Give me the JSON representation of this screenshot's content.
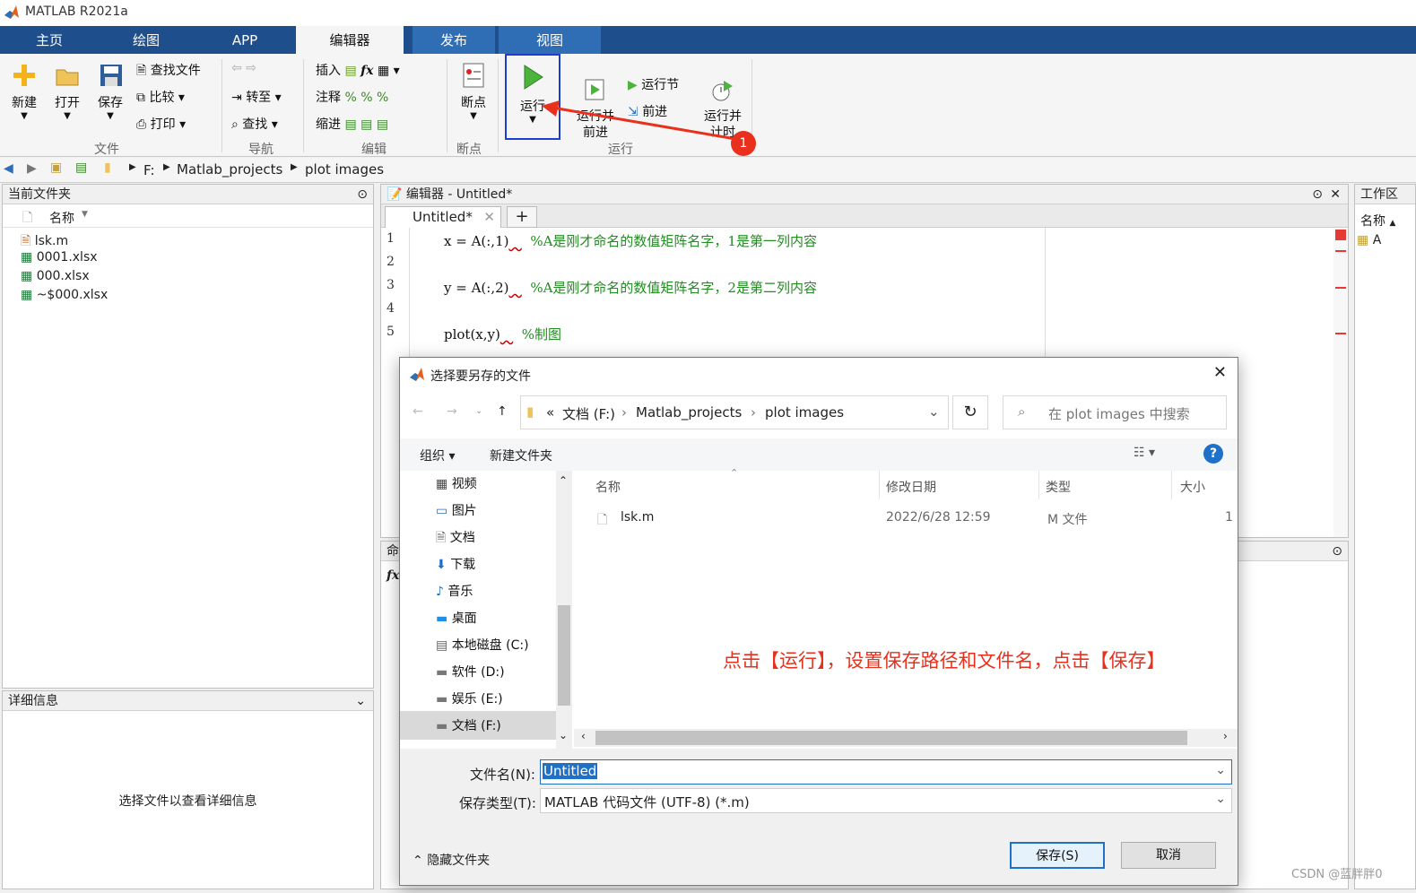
{
  "app": {
    "title": "MATLAB R2021a"
  },
  "tabs": [
    "主页",
    "绘图",
    "APP",
    "编辑器",
    "发布",
    "视图"
  ],
  "ribbon": {
    "file": {
      "new": "新建",
      "open": "打开",
      "save": "保存",
      "find_files": "查找文件",
      "compare": "比较",
      "print": "打印",
      "group": "文件"
    },
    "nav": {
      "goto": "转至",
      "find": "查找",
      "group": "导航"
    },
    "edit": {
      "insert": "插入",
      "comment": "注释",
      "indent": "缩进",
      "fx": "fx",
      "group": "编辑"
    },
    "breakpoints": {
      "label": "断点",
      "group": "断点"
    },
    "run": {
      "run": "运行",
      "run_advance": "运行并\n前进",
      "run_section": "运行节",
      "advance": "前进",
      "run_time": "运行并\n计时",
      "group": "运行",
      "annotation_badge": "1"
    }
  },
  "address": {
    "drive": "F:",
    "folder1": "Matlab_projects",
    "folder2": "plot images"
  },
  "current_folder": {
    "title": "当前文件夹",
    "col_name": "名称",
    "files": [
      "lsk.m",
      "0001.xlsx",
      "000.xlsx",
      "~$000.xlsx"
    ]
  },
  "details": {
    "title": "详细信息",
    "placeholder": "选择文件以查看详细信息"
  },
  "editor": {
    "title": "编辑器 - Untitled*",
    "tab": "Untitled*",
    "lines": [
      {
        "num": "1",
        "code": "x = A(:,1)",
        "comment": "%A是刚才命名的数值矩阵名字，1是第一列内容"
      },
      {
        "num": "2",
        "code": "",
        "comment": ""
      },
      {
        "num": "3",
        "code": "y = A(:,2)",
        "comment": "%A是刚才命名的数值矩阵名字，2是第二列内容"
      },
      {
        "num": "4",
        "code": "",
        "comment": ""
      },
      {
        "num": "5",
        "code": "plot(x,y)",
        "comment": "%制图"
      }
    ]
  },
  "command": {
    "title": "命",
    "prompt": "fx"
  },
  "workspace": {
    "title": "工作区",
    "col_name": "名称",
    "var": "A"
  },
  "dialog": {
    "title": "选择要另存的文件",
    "path_prefix": "«",
    "path": [
      "文档 (F:)",
      "Matlab_projects",
      "plot images"
    ],
    "search_placeholder": "在 plot images 中搜索",
    "organize": "组织",
    "new_folder": "新建文件夹",
    "nav": [
      "视频",
      "图片",
      "文档",
      "下载",
      "音乐",
      "桌面",
      "本地磁盘 (C:)",
      "软件 (D:)",
      "娱乐 (E:)",
      "文档 (F:)"
    ],
    "columns": [
      "名称",
      "修改日期",
      "类型",
      "大小"
    ],
    "files": [
      {
        "name": "lsk.m",
        "date": "2022/6/28 12:59",
        "type": "M 文件",
        "size": "1"
      }
    ],
    "annotation": "点击【运行】，设置保存路径和文件名，点击【保存】",
    "filename_label": "文件名(N):",
    "filename": "Untitled",
    "filetype_label": "保存类型(T):",
    "filetype": "MATLAB 代码文件 (UTF-8) (*.m)",
    "hide_folders": "隐藏文件夹",
    "save": "保存(S)",
    "cancel": "取消"
  },
  "watermark": "CSDN @蓝胖胖0",
  "colors": {
    "tabbar": "#1e4f8c",
    "annotation": "#e8301c",
    "highlight_box": "#1a3fd1"
  }
}
